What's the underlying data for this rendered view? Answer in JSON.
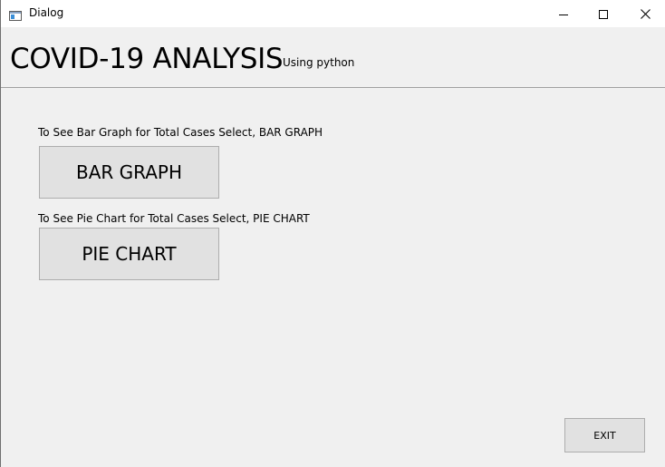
{
  "window": {
    "title": "Dialog",
    "app_icon": "dialog-app-icon",
    "controls": {
      "minimize_icon": "minimize-icon",
      "maximize_icon": "maximize-icon",
      "close_icon": "close-icon"
    }
  },
  "header": {
    "title": "COVID-19 ANALYSIS",
    "subtitle": "Using python"
  },
  "main": {
    "bar_graph": {
      "instruction": "To See Bar Graph for Total Cases Select, BAR GRAPH",
      "button_label": "BAR GRAPH"
    },
    "pie_chart": {
      "instruction": "To See Pie Chart for Total Cases Select, PIE CHART",
      "button_label": "PIE CHART"
    },
    "exit_label": "EXIT"
  },
  "colors": {
    "window_background": "#f0f0f0",
    "titlebar_background": "#ffffff",
    "button_face": "#e1e1e1",
    "button_border": "#adadad",
    "divider": "#a0a0a0"
  }
}
